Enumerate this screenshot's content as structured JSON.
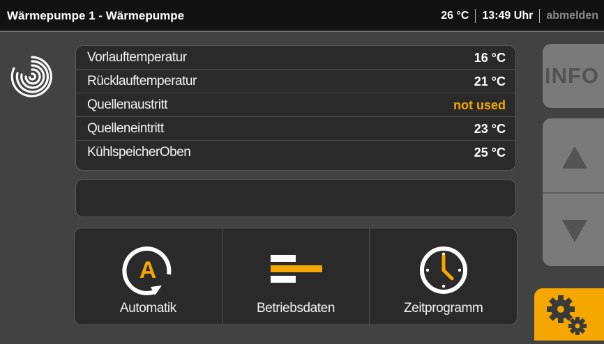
{
  "header": {
    "title": "Wärmepumpe 1 - Wärmepumpe",
    "temperature": "26 °C",
    "time": "13:49 Uhr",
    "logout_label": "abmelden"
  },
  "sensors": [
    {
      "label": "Vorlauftemperatur",
      "value": "16 °C"
    },
    {
      "label": "Rücklauftemperatur",
      "value": "21 °C"
    },
    {
      "label": "Quellenaustritt",
      "value": "not used"
    },
    {
      "label": "Quelleneintritt",
      "value": "23 °C"
    },
    {
      "label": "KühlspeicherOben",
      "value": "25 °C"
    }
  ],
  "functions": {
    "automatik": {
      "label": "Automatik",
      "icon": "automatic-mode-icon"
    },
    "betriebsdaten": {
      "label": "Betriebsdaten",
      "icon": "operating-data-icon"
    },
    "zeitprogramm": {
      "label": "Zeitprogramm",
      "icon": "clock-icon"
    }
  },
  "side": {
    "info_label": "INFO",
    "up_icon": "arrow-up-icon",
    "down_icon": "arrow-down-icon",
    "settings_icon": "gears-icon"
  },
  "colors": {
    "accent": "#f5a700",
    "value_normal": "#ffffff",
    "value_unused": "#f5a700",
    "background": "#424242",
    "panel": "#2a2a2a",
    "header": "#121212"
  }
}
